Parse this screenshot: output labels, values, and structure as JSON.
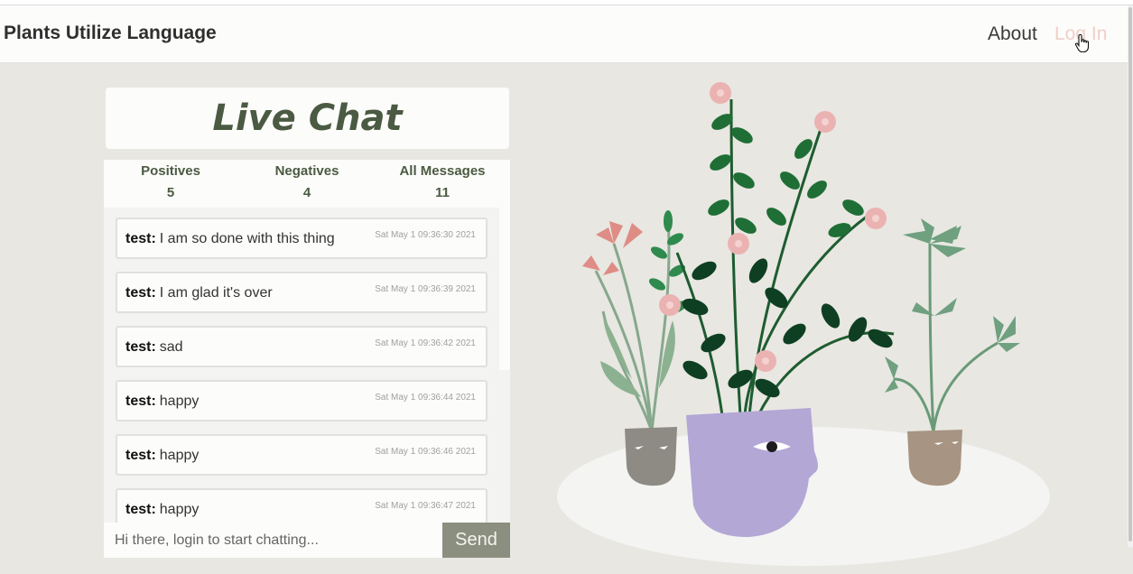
{
  "nav": {
    "brand": "Plants Utilize Language",
    "about": "About",
    "login": "Log In"
  },
  "chat": {
    "title": "Live Chat",
    "stats": {
      "positives_label": "Positives",
      "positives_count": "5",
      "negatives_label": "Negatives",
      "negatives_count": "4",
      "all_label": "All Messages",
      "all_count": "11"
    },
    "messages": [
      {
        "user": "test:",
        "text": "I am so done with this thing",
        "time": "Sat May 1 09:36:30 2021"
      },
      {
        "user": "test:",
        "text": "I am glad it's over",
        "time": "Sat May 1 09:36:39 2021"
      },
      {
        "user": "test:",
        "text": "sad",
        "time": "Sat May 1 09:36:42 2021"
      },
      {
        "user": "test:",
        "text": "happy",
        "time": "Sat May 1 09:36:44 2021"
      },
      {
        "user": "test:",
        "text": "happy",
        "time": "Sat May 1 09:36:46 2021"
      },
      {
        "user": "test:",
        "text": "happy",
        "time": "Sat May 1 09:36:47 2021"
      }
    ],
    "input_placeholder": "Hi there, login to start chatting...",
    "send_label": "Send"
  },
  "colors": {
    "background": "#e8e7e2",
    "accent_green": "#4b5a42",
    "send_button": "#8b8f7f",
    "login_link": "#f0cfc8"
  }
}
